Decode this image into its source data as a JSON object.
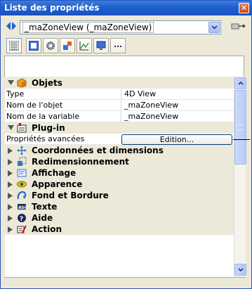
{
  "window": {
    "title": "Liste des propriétés"
  },
  "selector": {
    "value": "_maZoneView (_maZoneView)"
  },
  "tabs": [
    {
      "icon": "list-icon",
      "active": true
    },
    {
      "icon": "form-icon",
      "active": false
    },
    {
      "icon": "gear-icon",
      "active": false
    },
    {
      "icon": "shapes-icon",
      "active": false
    },
    {
      "icon": "chart-icon",
      "active": false
    },
    {
      "icon": "monitor-icon",
      "active": false
    },
    {
      "icon": "more-icon",
      "active": false
    }
  ],
  "groups": {
    "objets": {
      "label": "Objets",
      "expanded": true
    },
    "plugin": {
      "label": "Plug-in",
      "expanded": true
    },
    "coordonnees": {
      "label": "Coordonnées et dimensions"
    },
    "redimensionnement": {
      "label": "Redimensionnement"
    },
    "affichage": {
      "label": "Affichage"
    },
    "apparence": {
      "label": "Apparence"
    },
    "fond": {
      "label": "Fond et Bordure"
    },
    "texte": {
      "label": "Texte"
    },
    "aide": {
      "label": "Aide"
    },
    "action": {
      "label": "Action"
    }
  },
  "props": {
    "type": {
      "name": "Type",
      "value": "4D View"
    },
    "nom_objet": {
      "name": "Nom de l'objet",
      "value": "_maZoneView"
    },
    "nom_variable": {
      "name": "Nom de la variable",
      "value": "_maZoneView"
    },
    "proprietes_avancees": {
      "name": "Propriétés avancées",
      "button": "Edition..."
    }
  },
  "colors": {
    "title_bar": "#1f5fcf",
    "group_bg": "#ece9d8",
    "close": "#c8431b"
  }
}
